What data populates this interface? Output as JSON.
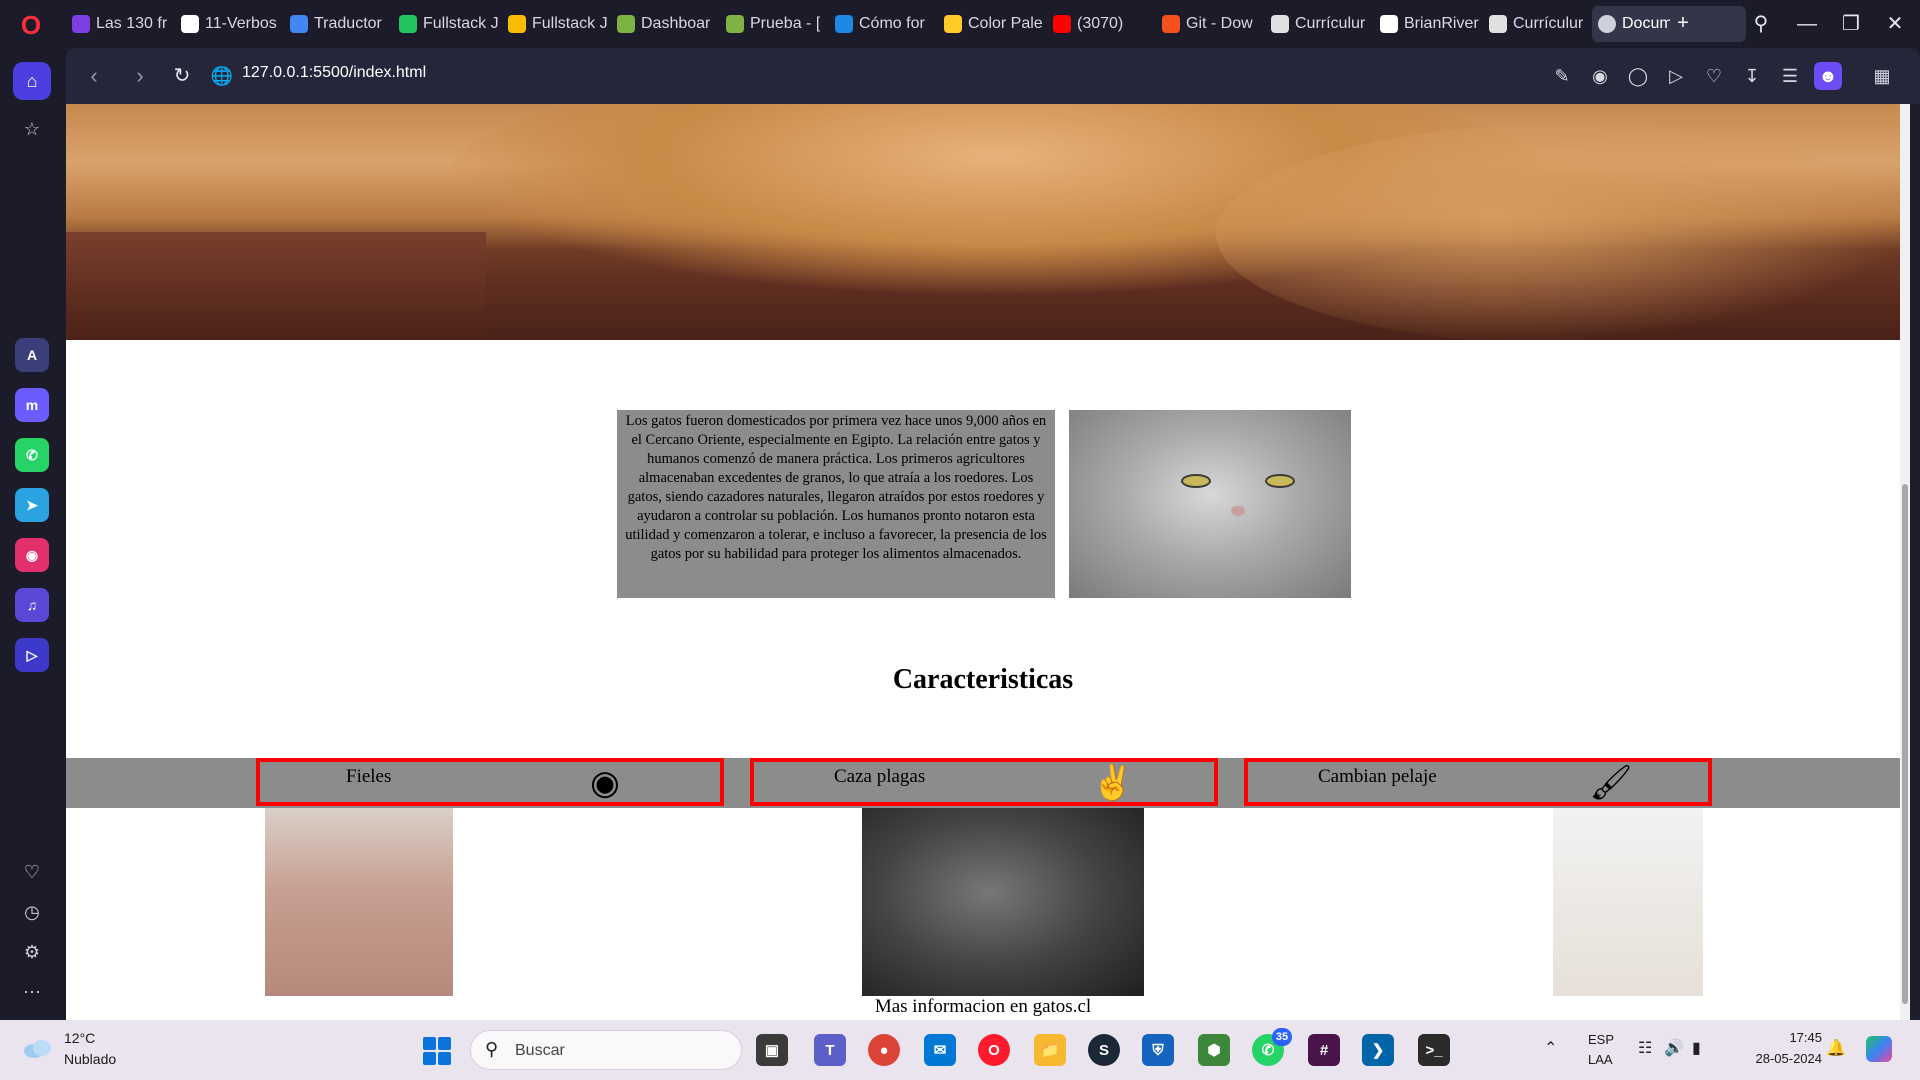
{
  "browser": {
    "tabs": [
      {
        "label": "Las 130 fr",
        "color": "#7b3fe4"
      },
      {
        "label": "11-Verbos",
        "color": "#ffffff"
      },
      {
        "label": "Traductor",
        "color": "#4285f4"
      },
      {
        "label": "Fullstack J",
        "color": "#22c55e"
      },
      {
        "label": "Fullstack J",
        "color": "#fbbc04"
      },
      {
        "label": "Dashboar",
        "color": "#7cb342"
      },
      {
        "label": "Prueba - [",
        "color": "#7cb342"
      },
      {
        "label": "Cómo for",
        "color": "#1e88e5"
      },
      {
        "label": "Color Pale",
        "color": "#ffca28"
      },
      {
        "label": "(3070)",
        "color": "#ff0000"
      },
      {
        "label": "Git - Dow",
        "color": "#f4511e"
      },
      {
        "label": "Currículur",
        "color": "#e0e0e0"
      },
      {
        "label": "BrianRiver",
        "color": "#ffffff"
      },
      {
        "label": "Currículur",
        "color": "#e0e0e0"
      }
    ],
    "active_tab": "Document",
    "url": "127.0.0.1:5500/index.html"
  },
  "page": {
    "intro_text": "Los gatos fueron domesticados por primera vez hace unos 9,000 años en el Cercano Oriente, especialmente en Egipto. La relación entre gatos y humanos comenzó de manera práctica. Los primeros agricultores almacenaban excedentes de granos, lo que atraía a los roedores. Los gatos, siendo cazadores naturales, llegaron atraídos por estos roedores y ayudaron a controlar su población. Los humanos pronto notaron esta utilidad y comenzaron a tolerar, e incluso a favorecer, la presencia de los gatos por su habilidad para proteger los alimentos almacenados.",
    "section_title": "Caracteristicas",
    "features": [
      {
        "label": "Fieles",
        "icon": "eye-icon"
      },
      {
        "label": "Caza plagas",
        "icon": "victory-hand-icon"
      },
      {
        "label": "Cambian pelaje",
        "icon": "paintbrush-icon"
      }
    ],
    "more_info": "Mas informacion en gatos.cl"
  },
  "taskbar": {
    "weather_temp": "12°C",
    "weather_desc": "Nublado",
    "search_placeholder": "Buscar",
    "whatsapp_badge": "35",
    "lang_line1": "ESP",
    "lang_line2": "LAA",
    "time": "17:45",
    "date": "28-05-2024"
  }
}
